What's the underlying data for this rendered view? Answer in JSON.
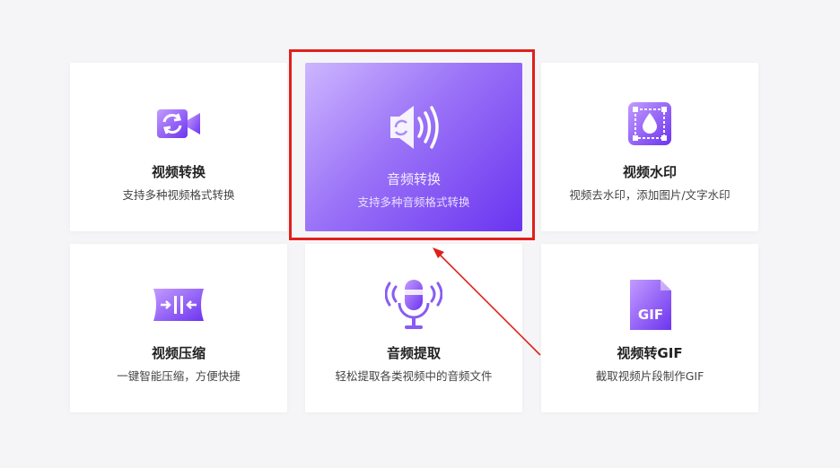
{
  "cards": [
    {
      "title": "视频转换",
      "desc": "支持多种视频格式转换",
      "icon": "video-convert-icon"
    },
    {
      "title": "音频转换",
      "desc": "支持多种音频格式转换",
      "icon": "audio-convert-icon"
    },
    {
      "title": "视频水印",
      "desc": "视频去水印，添加图片/文字水印",
      "icon": "watermark-icon"
    },
    {
      "title": "视频压缩",
      "desc": "一键智能压缩，方便快捷",
      "icon": "compress-icon"
    },
    {
      "title": "音频提取",
      "desc": "轻松提取各类视频中的音频文件",
      "icon": "microphone-icon"
    },
    {
      "title": "视频转GIF",
      "desc": "截取视频片段制作GIF",
      "icon": "gif-icon"
    }
  ],
  "gif_icon_text": "GIF",
  "colors": {
    "accent": "#7b4cf3",
    "highlight_border": "#e0201c",
    "active_gradient_start": "#cdb6ff",
    "active_gradient_end": "#6a34f0"
  }
}
